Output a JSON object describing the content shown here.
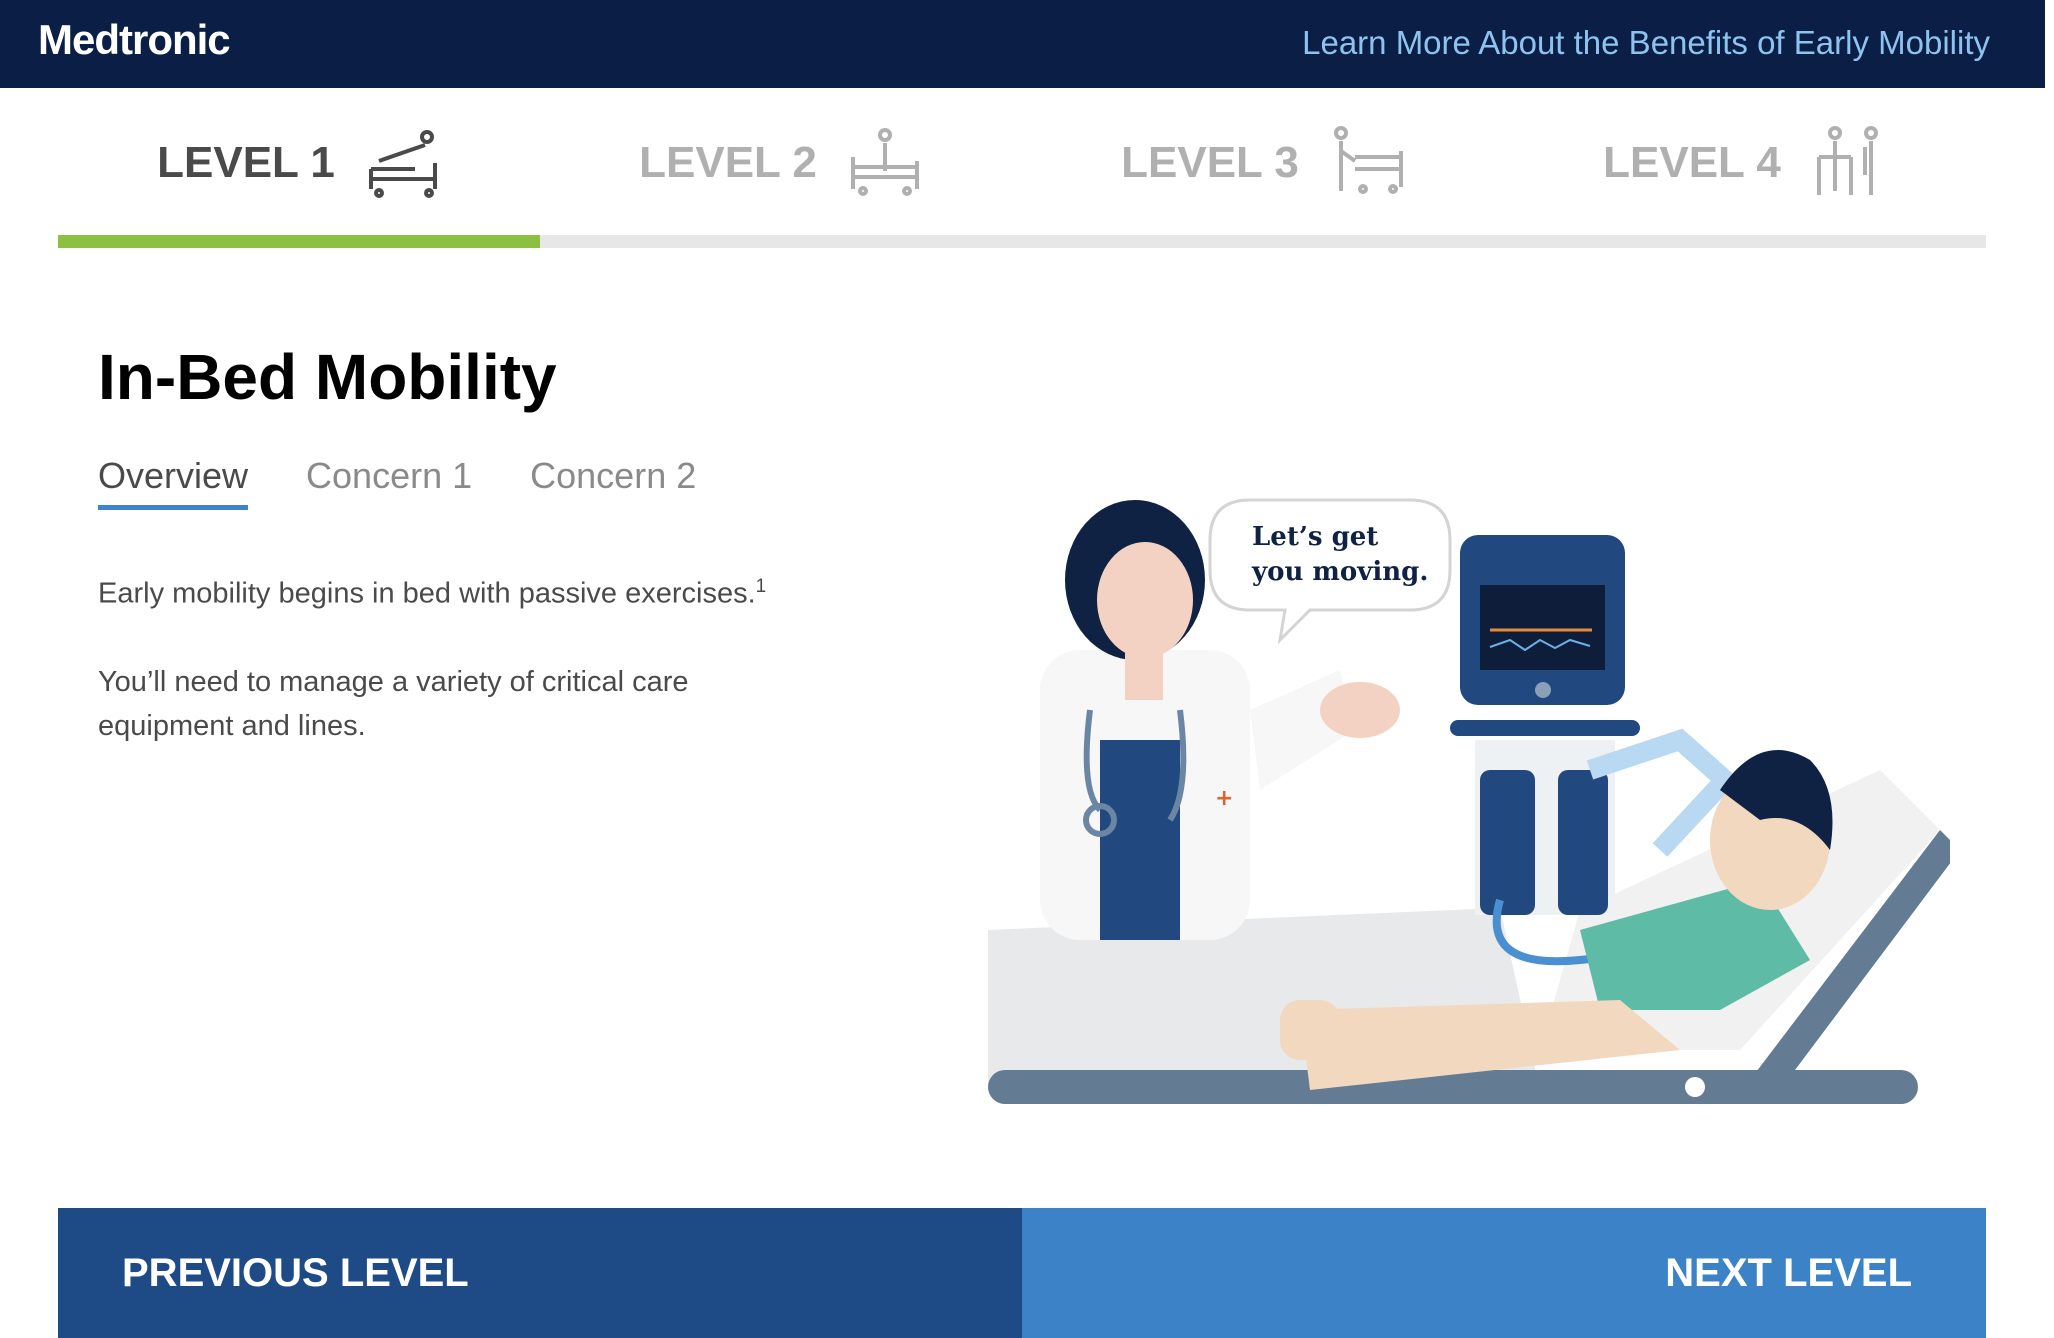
{
  "header": {
    "logo": "Medtronic",
    "link": "Learn More About the Benefits of Early Mobility"
  },
  "levels": [
    {
      "label": "LEVEL 1",
      "icon": "bed-icon",
      "active": true
    },
    {
      "label": "LEVEL 2",
      "icon": "sitting-patient-icon",
      "active": false
    },
    {
      "label": "LEVEL 3",
      "icon": "standing-by-bed-icon",
      "active": false
    },
    {
      "label": "LEVEL 4",
      "icon": "walking-with-walker-icon",
      "active": false
    }
  ],
  "progress": {
    "current_level": 1,
    "total_levels": 4,
    "fraction": 0.25
  },
  "colors": {
    "header_bg": "#0b1f46",
    "link": "#8ec3f0",
    "progress_fill": "#8bc040",
    "tab_underline": "#3f83c8",
    "prev_button": "#1e4a86",
    "next_button": "#3b83c6"
  },
  "content": {
    "title": "In-Bed Mobility",
    "tabs": [
      "Overview",
      "Concern 1",
      "Concern 2"
    ],
    "active_tab": "Overview",
    "paragraph1": "Early mobility begins in bed with passive exercises.",
    "paragraph1_ref": "1",
    "paragraph2": "You’ll need to manage a variety of critical care equipment and lines."
  },
  "illustration": {
    "speech_line1": "Let’s get",
    "speech_line2": "you moving."
  },
  "nav": {
    "prev": "PREVIOUS LEVEL",
    "next": "NEXT LEVEL"
  }
}
